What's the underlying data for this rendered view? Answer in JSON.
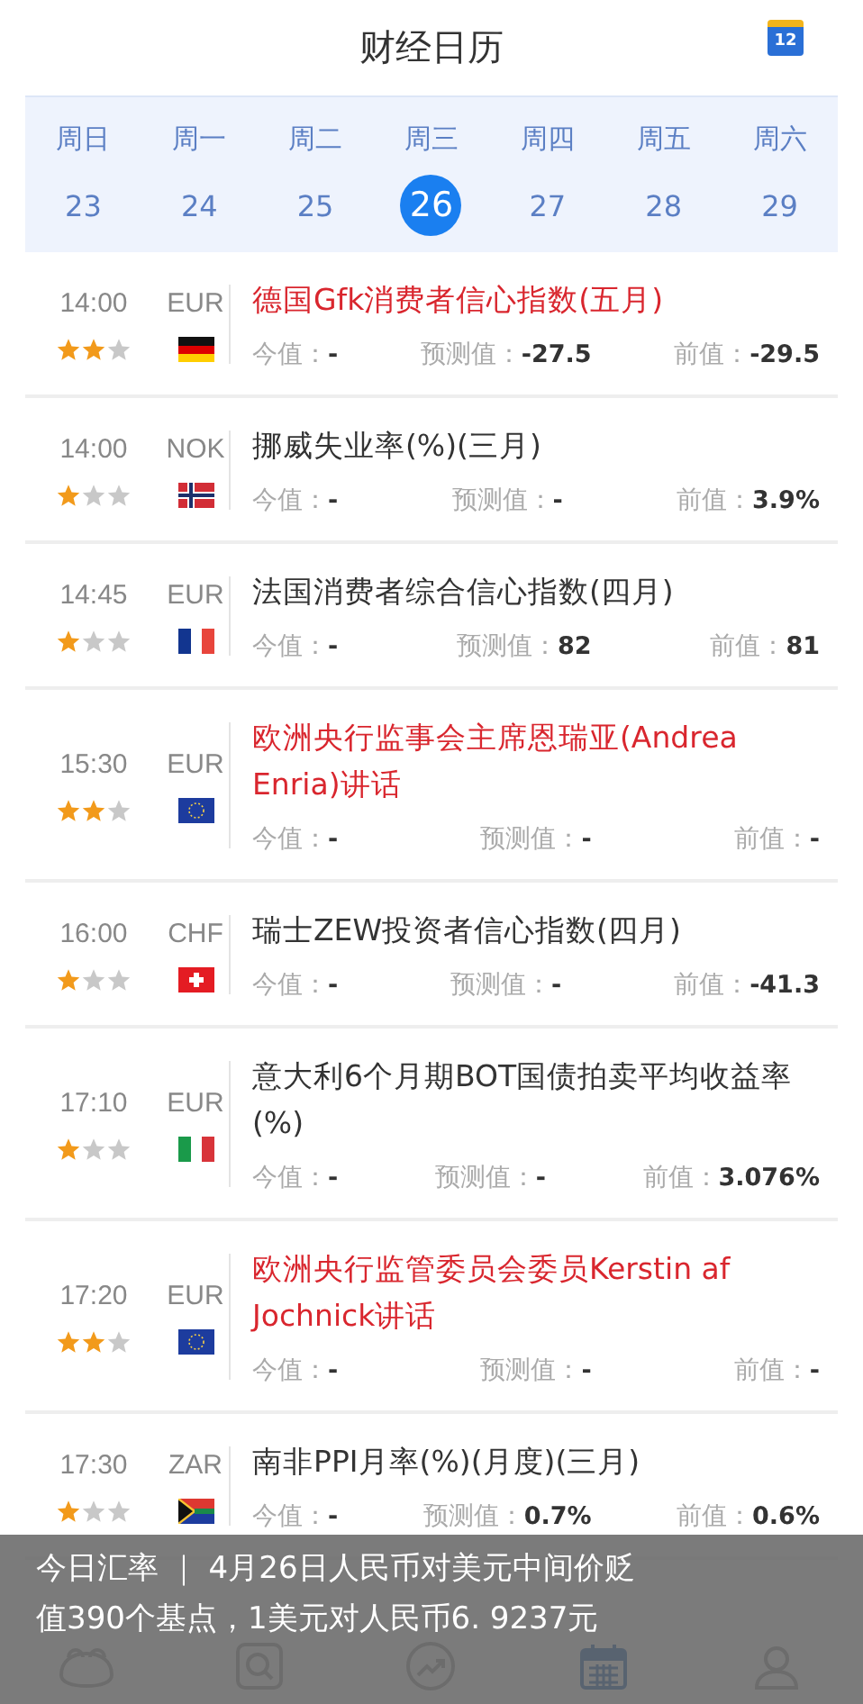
{
  "header": {
    "title": "财经日历",
    "calendar_day": "12"
  },
  "week": [
    {
      "weekday": "周日",
      "date": "23",
      "selected": false
    },
    {
      "weekday": "周一",
      "date": "24",
      "selected": false
    },
    {
      "weekday": "周二",
      "date": "25",
      "selected": false
    },
    {
      "weekday": "周三",
      "date": "26",
      "selected": true
    },
    {
      "weekday": "周四",
      "date": "27",
      "selected": false
    },
    {
      "weekday": "周五",
      "date": "28",
      "selected": false
    },
    {
      "weekday": "周六",
      "date": "29",
      "selected": false
    }
  ],
  "events": [
    {
      "time": "14:00",
      "currency": "EUR",
      "stars": 2,
      "flag": {
        "kind": "de"
      },
      "important": true,
      "title": "德国Gfk消费者信心指数(五月)",
      "values": [
        {
          "label": "今值：",
          "value": "-"
        },
        {
          "label": "预测值：",
          "value": "-27.5"
        },
        {
          "label": "前值：",
          "value": "-29.5"
        }
      ]
    },
    {
      "time": "14:00",
      "currency": "NOK",
      "stars": 1,
      "flag": {
        "kind": "no"
      },
      "important": false,
      "title": "挪威失业率(%)(三月)",
      "values": [
        {
          "label": "今值：",
          "value": "-"
        },
        {
          "label": "预测值：",
          "value": "-"
        },
        {
          "label": "前值：",
          "value": "3.9%"
        }
      ]
    },
    {
      "time": "14:45",
      "currency": "EUR",
      "stars": 1,
      "flag": {
        "kind": "fr"
      },
      "important": false,
      "title": "法国消费者综合信心指数(四月)",
      "values": [
        {
          "label": "今值：",
          "value": "-"
        },
        {
          "label": "预测值：",
          "value": "82"
        },
        {
          "label": "前值：",
          "value": "81"
        }
      ]
    },
    {
      "time": "15:30",
      "currency": "EUR",
      "stars": 2,
      "flag": {
        "kind": "eu"
      },
      "important": true,
      "title": "欧洲央行监事会主席恩瑞亚(Andrea Enria)讲话",
      "values": [
        {
          "label": "今值：",
          "value": "-"
        },
        {
          "label": "预测值：",
          "value": "-"
        },
        {
          "label": "前值：",
          "value": "-"
        }
      ]
    },
    {
      "time": "16:00",
      "currency": "CHF",
      "stars": 1,
      "flag": {
        "kind": "ch"
      },
      "important": false,
      "title": "瑞士ZEW投资者信心指数(四月)",
      "values": [
        {
          "label": "今值：",
          "value": "-"
        },
        {
          "label": "预测值：",
          "value": "-"
        },
        {
          "label": "前值：",
          "value": "-41.3"
        }
      ]
    },
    {
      "time": "17:10",
      "currency": "EUR",
      "stars": 1,
      "flag": {
        "kind": "it"
      },
      "important": false,
      "title": "意大利6个月期BOT国债拍卖平均收益率(%)",
      "values": [
        {
          "label": "今值：",
          "value": "-"
        },
        {
          "label": "预测值：",
          "value": "-"
        },
        {
          "label": "前值：",
          "value": "3.076%"
        }
      ]
    },
    {
      "time": "17:20",
      "currency": "EUR",
      "stars": 2,
      "flag": {
        "kind": "eu"
      },
      "important": true,
      "title": "欧洲央行监管委员会委员Kerstin af Jochnick讲话",
      "values": [
        {
          "label": "今值：",
          "value": "-"
        },
        {
          "label": "预测值：",
          "value": "-"
        },
        {
          "label": "前值：",
          "value": "-"
        }
      ]
    },
    {
      "time": "17:30",
      "currency": "ZAR",
      "stars": 1,
      "flag": {
        "kind": "za"
      },
      "important": false,
      "title": "南非PPI月率(%)(月度)(三月)",
      "values": [
        {
          "label": "今值：",
          "value": "-"
        },
        {
          "label": "预测值：",
          "value": "0.7%"
        },
        {
          "label": "前值：",
          "value": "0.6%"
        }
      ]
    }
  ],
  "tab_bar": [
    {
      "kind": "frog",
      "selected": false
    },
    {
      "kind": "search",
      "selected": false
    },
    {
      "kind": "trend",
      "selected": false
    },
    {
      "kind": "calendar",
      "selected": true
    },
    {
      "kind": "user",
      "selected": false
    }
  ],
  "caption": "今日汇率 ｜ 4月26日人民币对美元中间价贬值390个基点，1美元对人民币6. 9237元"
}
